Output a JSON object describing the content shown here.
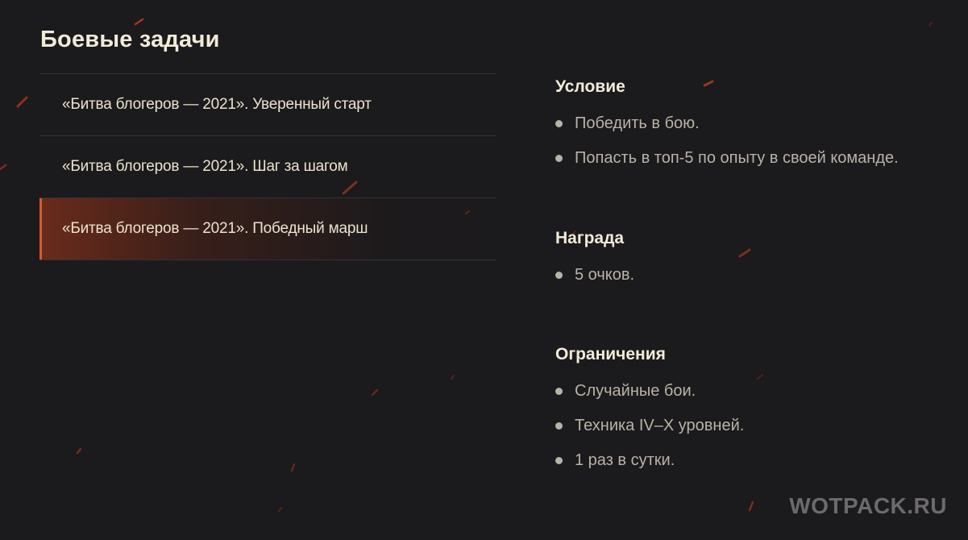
{
  "page": {
    "title": "Боевые задачи"
  },
  "missions": [
    {
      "label": "«Битва блогеров — 2021». Уверенный старт",
      "active": false
    },
    {
      "label": "«Битва блогеров — 2021». Шаг за шагом",
      "active": false
    },
    {
      "label": "«Битва блогеров — 2021». Победный марш",
      "active": true
    }
  ],
  "details": {
    "condition": {
      "title": "Условие",
      "items": [
        "Победить в бою.",
        "Попасть в топ-5 по опыту в своей команде."
      ]
    },
    "reward": {
      "title": "Награда",
      "items": [
        "5 очков."
      ]
    },
    "restrictions": {
      "title": "Ограничения",
      "items": [
        "Случайные бои.",
        "Техника IV–X уровней.",
        "1 раз в сутки."
      ]
    }
  },
  "watermark": "WOTPACK.RU",
  "colors": {
    "background": "#1b1a1c",
    "accent": "#d75a2a",
    "heading": "#f2ebd8",
    "body_text": "#b9b3a7"
  }
}
